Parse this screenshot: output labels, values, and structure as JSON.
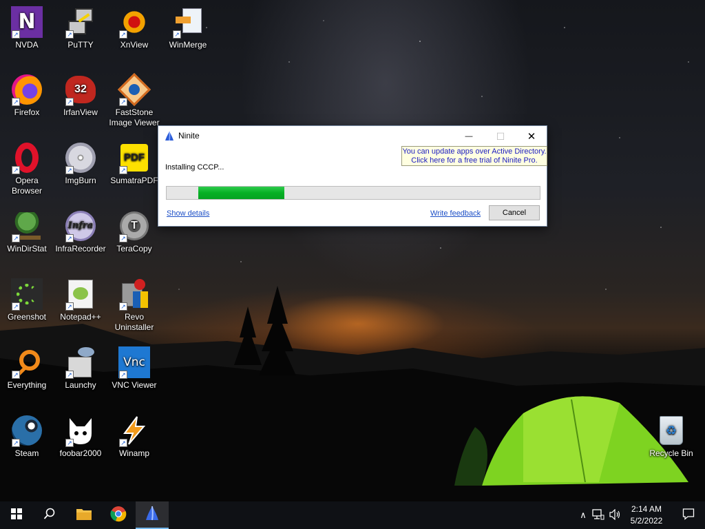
{
  "desktop": {
    "icons": [
      {
        "label": "NVDA",
        "icon": "nvda-icon"
      },
      {
        "label": "PuTTY",
        "icon": "putty-icon"
      },
      {
        "label": "XnView",
        "icon": "xnview-icon"
      },
      {
        "label": "WinMerge",
        "icon": "winmerge-icon"
      },
      {
        "label": "Firefox",
        "icon": "firefox-icon"
      },
      {
        "label": "IrfanView",
        "icon": "irfanview-icon"
      },
      {
        "label": "FastStone Image Viewer",
        "icon": "faststone-icon"
      },
      {
        "label": "Opera Browser",
        "icon": "opera-icon"
      },
      {
        "label": "ImgBurn",
        "icon": "imgburn-icon"
      },
      {
        "label": "SumatraPDF",
        "icon": "sumatrapdf-icon"
      },
      {
        "label": "WinDirStat",
        "icon": "windirstat-icon"
      },
      {
        "label": "InfraRecorder",
        "icon": "infrarecorder-icon"
      },
      {
        "label": "TeraCopy",
        "icon": "teracopy-icon"
      },
      {
        "label": "Greenshot",
        "icon": "greenshot-icon"
      },
      {
        "label": "Notepad++",
        "icon": "notepadpp-icon"
      },
      {
        "label": "Revo Uninstaller",
        "icon": "revo-uninstaller-icon"
      },
      {
        "label": "Everything",
        "icon": "everything-icon"
      },
      {
        "label": "Launchy",
        "icon": "launchy-icon"
      },
      {
        "label": "VNC Viewer",
        "icon": "vnc-viewer-icon"
      },
      {
        "label": "Steam",
        "icon": "steam-icon"
      },
      {
        "label": "foobar2000",
        "icon": "foobar2000-icon"
      },
      {
        "label": "Winamp",
        "icon": "winamp-icon"
      },
      {
        "label": "Recycle Bin",
        "icon": "recycle-bin-icon"
      }
    ],
    "nvda_text": "N",
    "irfanview_badge": "32",
    "sumatra_text": "PDF",
    "infrarecorder_text": "Infra",
    "teracopy_text": "T",
    "vnc_text": "Vnc"
  },
  "ninite_window": {
    "title": "Ninite",
    "minimize_symbol": "—",
    "maximize_symbol": "☐",
    "close_symbol": "✕",
    "ad_line1": "You can update apps over Active Directory.",
    "ad_line2": "Click here for a free trial of Ninite Pro.",
    "status": "Installing CCCP...",
    "progress_fraction": 0.23,
    "progress_bar_color": "#06b025",
    "show_details": "Show details",
    "write_feedback": "Write feedback",
    "cancel": "Cancel"
  },
  "taskbar": {
    "start_icon": "windows-start-icon",
    "search_icon": "search-icon",
    "pinned": [
      {
        "name": "file-explorer",
        "icon": "folder-icon"
      },
      {
        "name": "chrome",
        "icon": "chrome-icon"
      },
      {
        "name": "ninite",
        "icon": "ninite-icon",
        "active": true
      }
    ],
    "tray": {
      "chevron": "∧",
      "network_icon": "network-icon",
      "volume_icon": "volume-icon",
      "notification_icon": "notification-icon"
    },
    "time": "2:14 AM",
    "date": "5/2/2022"
  },
  "colors": {
    "taskbar_bg": "#101216",
    "link_blue": "#1b4ec6",
    "ad_bg": "#ffffe1",
    "active_indicator": "#76b9ed"
  }
}
